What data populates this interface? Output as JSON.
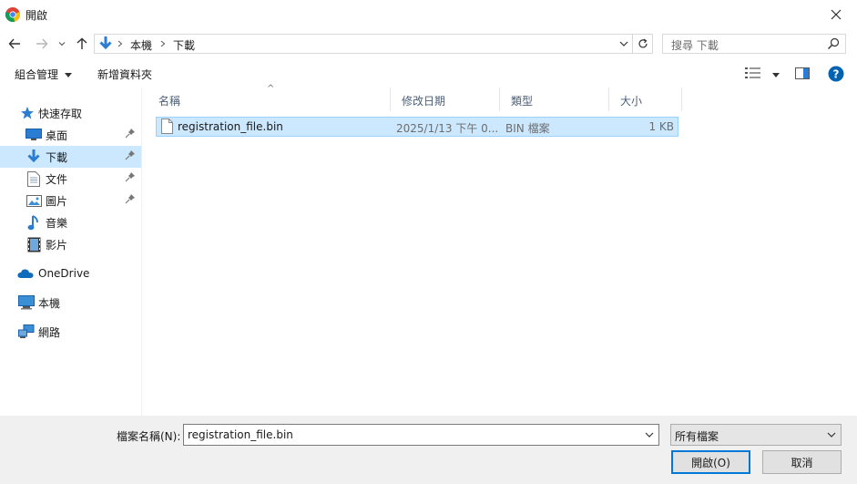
{
  "window": {
    "title": "開啟"
  },
  "nav": {
    "breadcrumbs": [
      "本機",
      "下載"
    ],
    "search_placeholder": "搜尋 下載"
  },
  "commands": {
    "organize": "組合管理",
    "new_folder": "新增資料夾"
  },
  "sidebar": {
    "items": [
      {
        "label": "快速存取"
      },
      {
        "label": "桌面"
      },
      {
        "label": "下載"
      },
      {
        "label": "文件"
      },
      {
        "label": "圖片"
      },
      {
        "label": "音樂"
      },
      {
        "label": "影片"
      },
      {
        "label": "OneDrive"
      },
      {
        "label": "本機"
      },
      {
        "label": "網路"
      }
    ]
  },
  "columns": [
    "名稱",
    "修改日期",
    "類型",
    "大小"
  ],
  "files": [
    {
      "name": "registration_file.bin",
      "modified": "2025/1/13 下午 0...",
      "type": "BIN 檔案",
      "size": "1 KB"
    }
  ],
  "footer": {
    "filename_label": "檔案名稱(N):",
    "filename_value": "registration_file.bin",
    "filetype_value": "所有檔案",
    "open_label": "開啟(O)",
    "cancel_label": "取消"
  },
  "colors": {
    "selection": "#cce8ff",
    "accent": "#0078d7",
    "help": "#0063b1"
  }
}
